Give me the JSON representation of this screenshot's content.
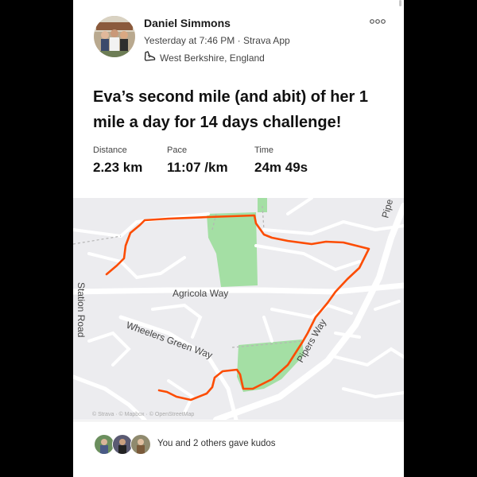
{
  "post": {
    "athlete_name": "Daniel Simmons",
    "timestamp": "Yesterday at 7:46 PM · Strava App",
    "location": "West Berkshire, England",
    "title_line1": "Eva’s second mile (and abit) of her  1",
    "title_line2": "mile a day for 14 days challenge!"
  },
  "stats": [
    {
      "label": "Distance",
      "value": "2.23 km"
    },
    {
      "label": "Pace",
      "value": "11:07 /km"
    },
    {
      "label": "Time",
      "value": "24m 49s"
    }
  ],
  "map": {
    "street_labels": [
      "Agricola Way",
      "Wheelers Green Way",
      "Pipers Way",
      "Station Road",
      "Pipe"
    ],
    "attribution": "© Strava · © Mapbox · © OpenStreetMap",
    "route_color": "#fc4c02",
    "park_color": "#a4dfa4"
  },
  "kudos": {
    "text": "You and 2 others gave kudos"
  },
  "icons": [
    "more-options-icon",
    "shoe-icon"
  ]
}
